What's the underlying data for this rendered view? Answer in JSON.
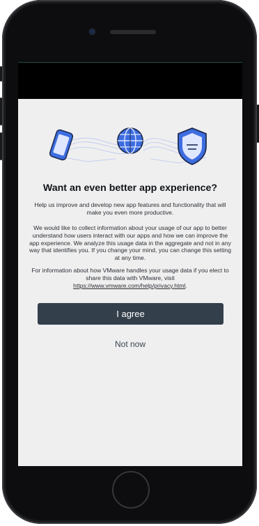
{
  "device": {
    "frame": "iPhone"
  },
  "hero": {
    "icons": [
      "phone-icon",
      "globe-icon",
      "shield-icon"
    ],
    "accent": "#3d6de0"
  },
  "dialog": {
    "title": "Want an even better app experience?",
    "paragraph1": "Help us improve and develop new app features and functionality that will make you even more productive.",
    "paragraph2": "We would like to collect information about your usage of our app to better understand how users interact with our apps and how we can improve the app experience. We analyze this usage data in the aggregate and not in any way that identifies you. If you change your mind, you can change this setting at any time.",
    "paragraph3_prefix": "For information about how VMware handles your usage data if you elect to share this data with VMware, visit ",
    "privacy_link": "https://www.vmware.com/help/privacy.html",
    "paragraph3_suffix": ".",
    "agree_label": "I agree",
    "notnow_label": "Not now"
  },
  "colors": {
    "button_bg": "#343f4c",
    "button_text": "#ffffff",
    "screen_bg": "#efefef"
  }
}
